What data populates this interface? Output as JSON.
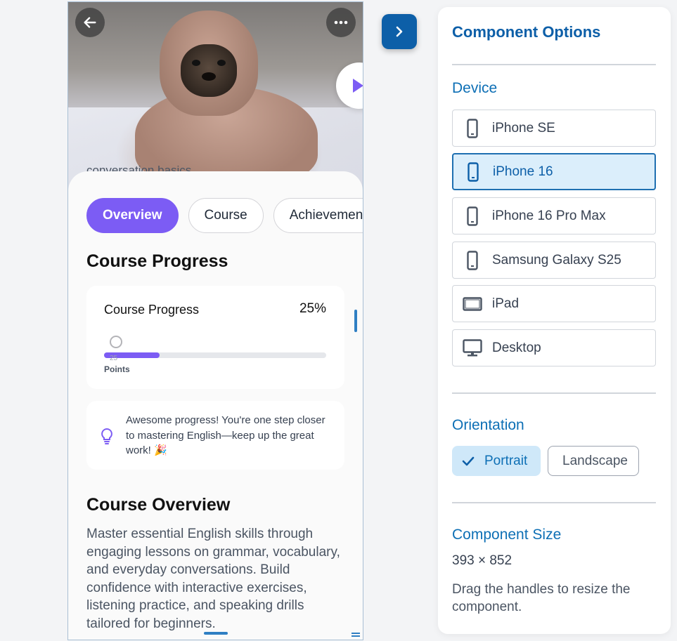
{
  "preview": {
    "peek_text": "conversation basics.",
    "tabs": [
      {
        "label": "Overview",
        "active": true
      },
      {
        "label": "Course",
        "active": false
      },
      {
        "label": "Achievements",
        "active": false
      }
    ],
    "progress_heading": "Course Progress",
    "progress_card": {
      "title": "Course Progress",
      "percent_label": "25%",
      "fraction": 0.25,
      "points_value": "25",
      "points_unit": "Points"
    },
    "tip": "Awesome progress! You're one step closer to mastering English—keep up the great work! 🎉",
    "overview_heading": "Course Overview",
    "overview_text": "Master essential English skills through engaging lessons on grammar, vocabulary, and everyday conversations. Build confidence with interactive exercises, listening practice, and speaking drills tailored for beginners."
  },
  "panel": {
    "title": "Component Options",
    "device_section": "Device",
    "devices": [
      {
        "label": "iPhone SE",
        "icon": "phone-icon",
        "selected": false
      },
      {
        "label": "iPhone 16",
        "icon": "phone-icon",
        "selected": true
      },
      {
        "label": "iPhone 16 Pro Max",
        "icon": "phone-icon",
        "selected": false
      },
      {
        "label": "Samsung Galaxy S25",
        "icon": "phone-icon",
        "selected": false
      },
      {
        "label": "iPad",
        "icon": "tablet-icon",
        "selected": false
      },
      {
        "label": "Desktop",
        "icon": "desktop-icon",
        "selected": false
      }
    ],
    "orientation_section": "Orientation",
    "orientation": {
      "portrait": "Portrait",
      "landscape": "Landscape",
      "selected": "Portrait"
    },
    "size_section": "Component Size",
    "size_value": "393 × 852",
    "size_help": "Drag the handles to resize the component."
  },
  "colors": {
    "accent_purple": "#7c5cf4",
    "brand_blue": "#0d5fa8",
    "selected_bg": "#dbeefb"
  }
}
